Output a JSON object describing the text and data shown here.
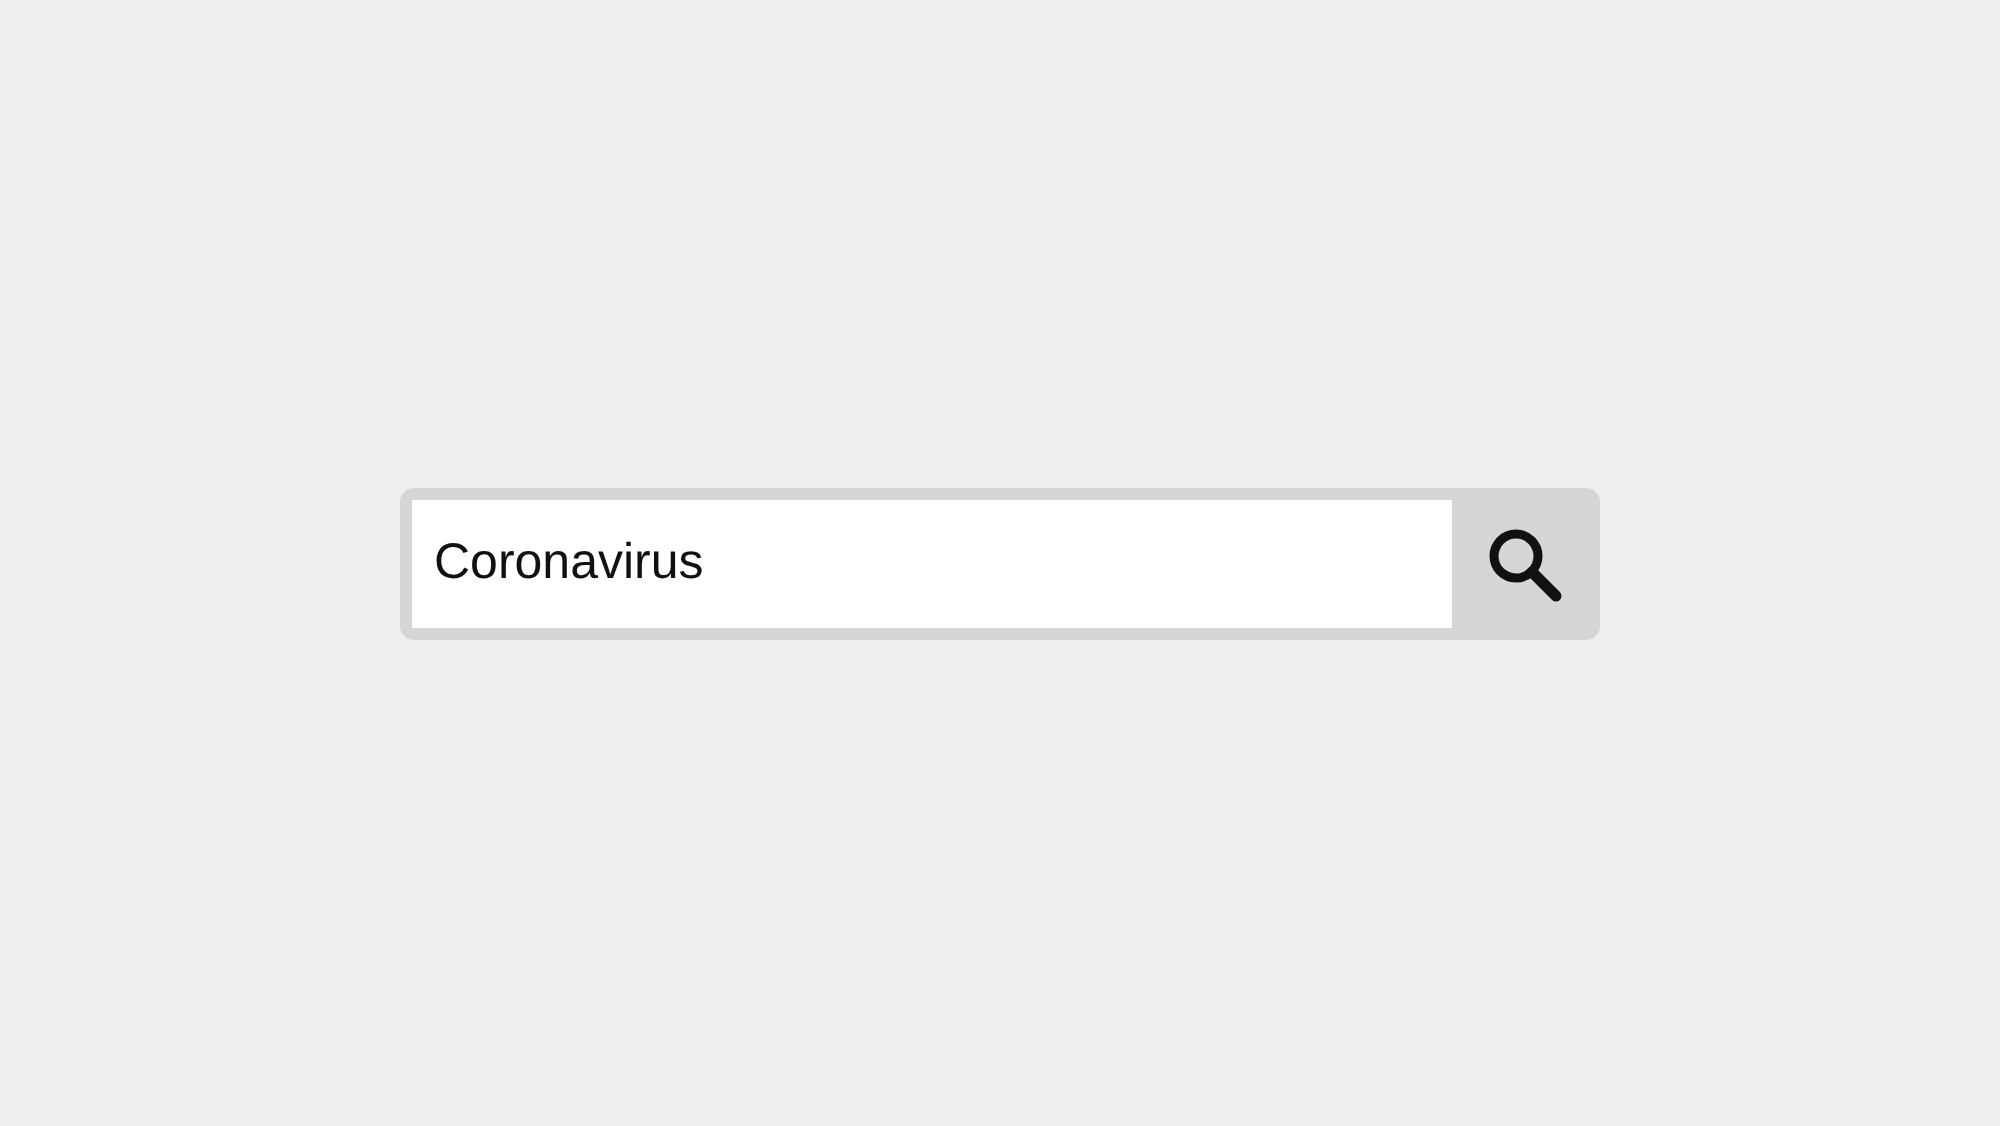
{
  "search": {
    "value": "Coronavirus"
  }
}
